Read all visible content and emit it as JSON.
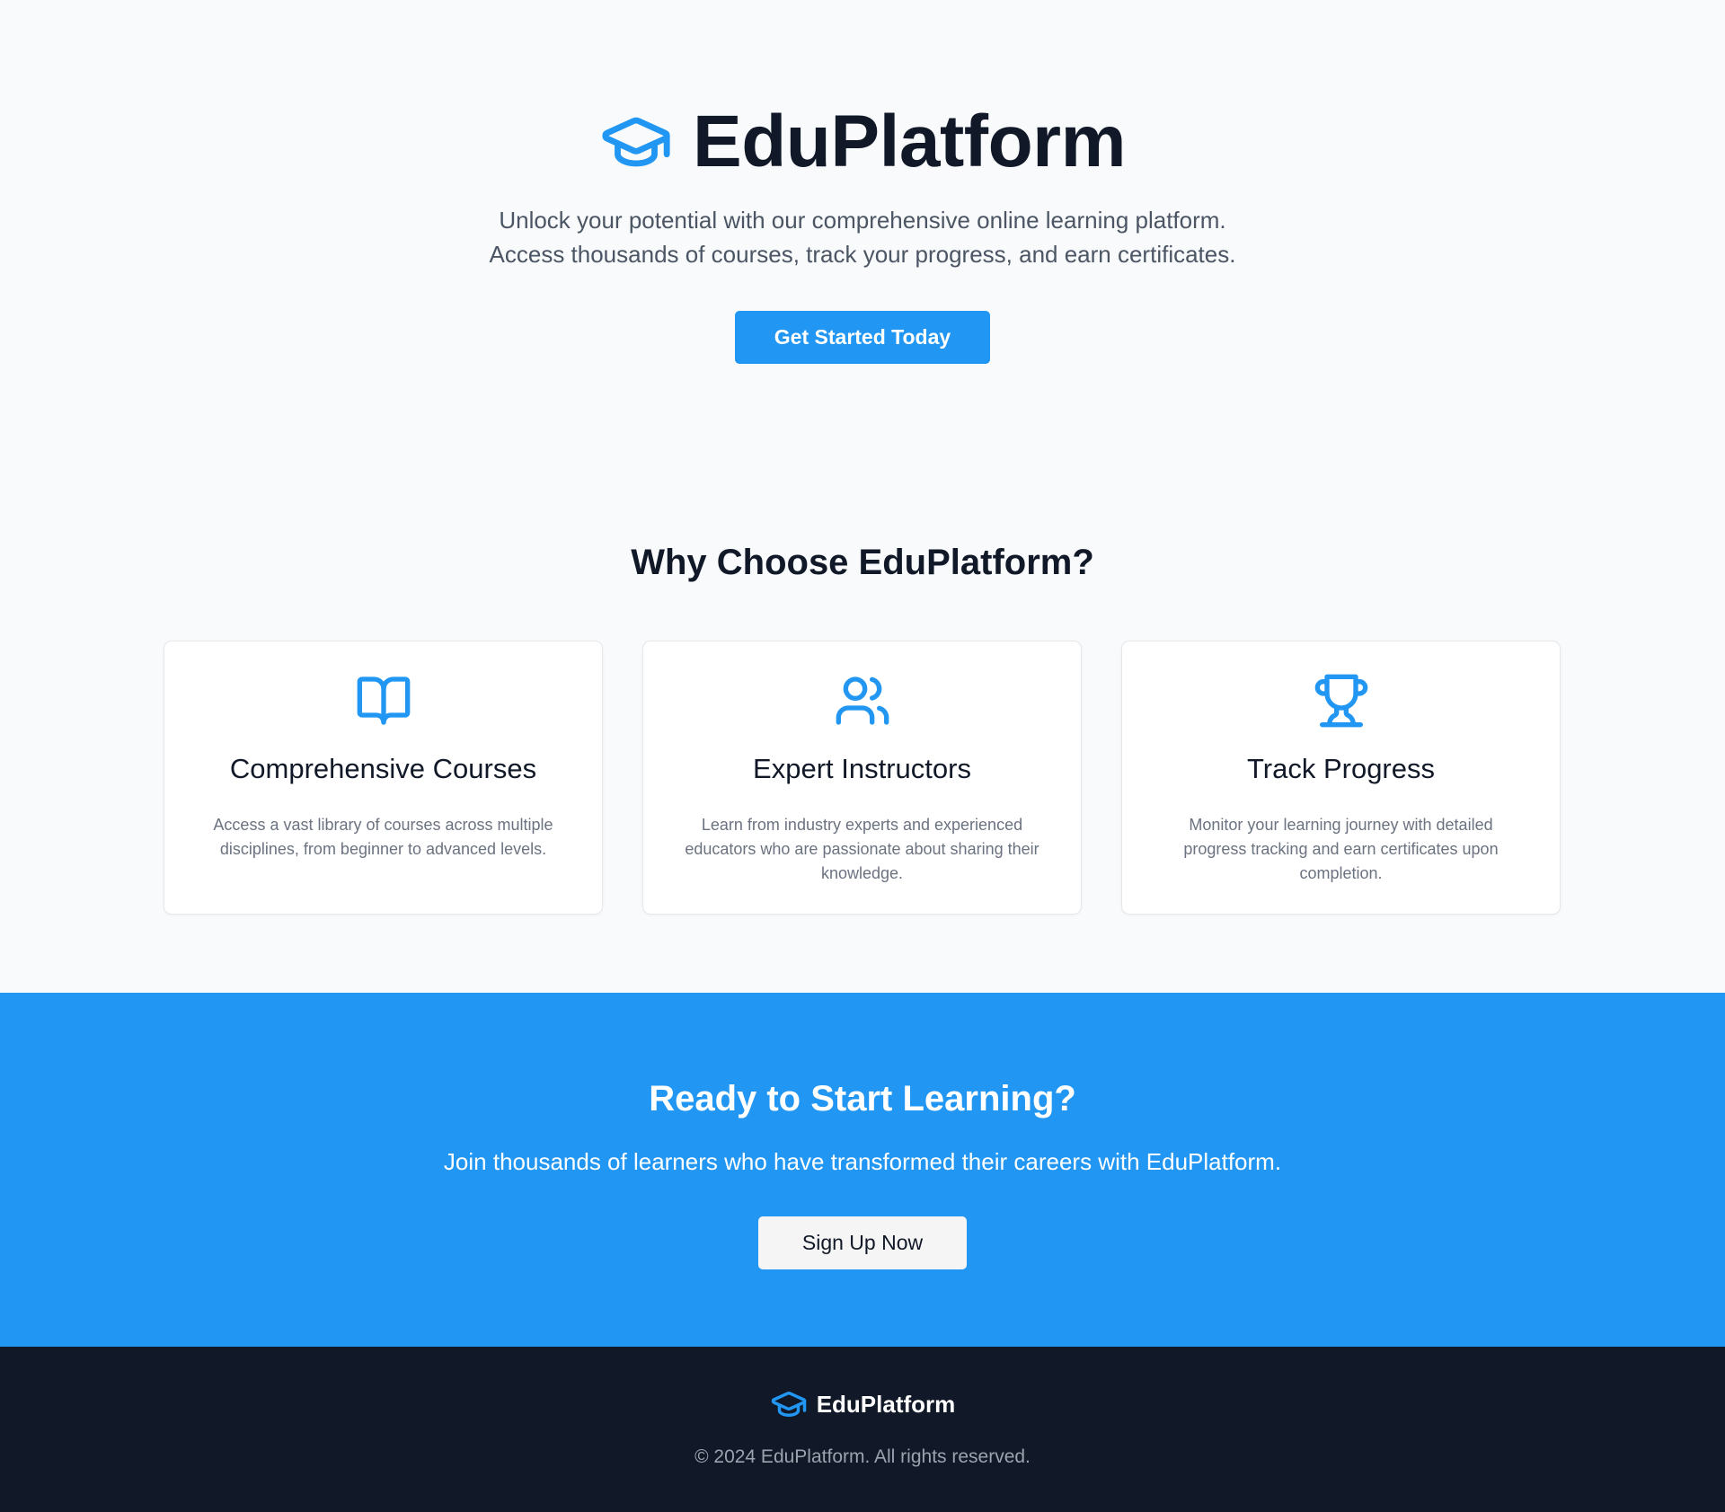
{
  "colors": {
    "accent": "#2196f3",
    "page_background": "#f8fafc",
    "footer_background": "#111827",
    "heading": "#111827",
    "body_text": "#4b5563",
    "muted_text": "#6b7280"
  },
  "hero": {
    "logo_icon": "graduation-cap-icon",
    "brand_name": "EduPlatform",
    "subtitle_line_1": "Unlock your potential with our comprehensive online learning platform.",
    "subtitle_line_2": "Access thousands of courses, track your progress, and earn certificates.",
    "cta_label": "Get Started Today"
  },
  "features": {
    "title": "Why Choose EduPlatform?",
    "cards": [
      {
        "icon": "book-open-icon",
        "title": "Comprehensive Courses",
        "description": "Access a vast library of courses across multiple disciplines, from beginner to advanced levels."
      },
      {
        "icon": "users-icon",
        "title": "Expert Instructors",
        "description": "Learn from industry experts and experienced educators who are passionate about sharing their knowledge."
      },
      {
        "icon": "trophy-icon",
        "title": "Track Progress",
        "description": "Monitor your learning journey with detailed progress tracking and earn certificates upon completion."
      }
    ]
  },
  "cta": {
    "title": "Ready to Start Learning?",
    "subtitle": "Join thousands of learners who have transformed their careers with EduPlatform.",
    "button_label": "Sign Up Now"
  },
  "footer": {
    "logo_icon": "graduation-cap-icon",
    "brand_name": "EduPlatform",
    "copyright": "© 2024 EduPlatform. All rights reserved."
  }
}
